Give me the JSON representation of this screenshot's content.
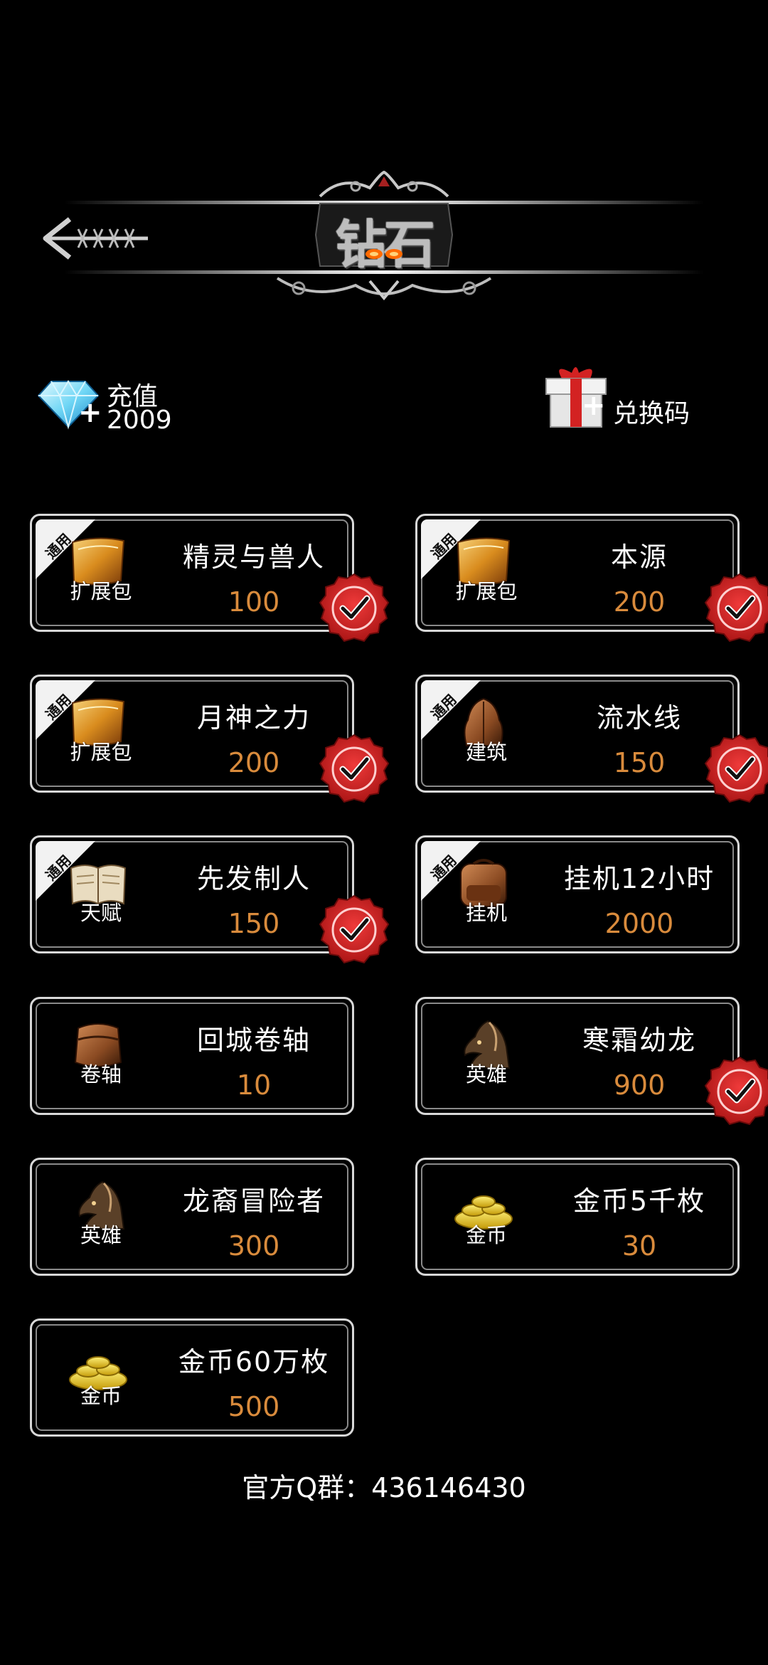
{
  "header": {
    "title": "钻石",
    "back_label": "××××"
  },
  "account": {
    "recharge_label": "充值",
    "diamond_count": "2009",
    "redeem_label": "兑换码"
  },
  "items": [
    {
      "tag": "通用",
      "category": "扩展包",
      "name": "精灵与兽人",
      "price": "100",
      "owned": true,
      "icon": "scroll-icon"
    },
    {
      "tag": "通用",
      "category": "扩展包",
      "name": "本源",
      "price": "200",
      "owned": true,
      "icon": "scroll-icon"
    },
    {
      "tag": "通用",
      "category": "扩展包",
      "name": "月神之力",
      "price": "200",
      "owned": true,
      "icon": "scroll-icon"
    },
    {
      "tag": "通用",
      "category": "建筑",
      "name": "流水线",
      "price": "150",
      "owned": true,
      "icon": "building-icon"
    },
    {
      "tag": "通用",
      "category": "天赋",
      "name": "先发制人",
      "price": "150",
      "owned": true,
      "icon": "book-icon"
    },
    {
      "tag": "通用",
      "category": "挂机",
      "name": "挂机12小时",
      "price": "2000",
      "owned": false,
      "icon": "backpack-icon"
    },
    {
      "tag": "",
      "category": "卷轴",
      "name": "回城卷轴",
      "price": "10",
      "owned": false,
      "icon": "bag-icon"
    },
    {
      "tag": "",
      "category": "英雄",
      "name": "寒霜幼龙",
      "price": "900",
      "owned": true,
      "icon": "hero-icon"
    },
    {
      "tag": "",
      "category": "英雄",
      "name": "龙裔冒险者",
      "price": "300",
      "owned": false,
      "icon": "hero-icon"
    },
    {
      "tag": "",
      "category": "金币",
      "name": "金币5千枚",
      "price": "30",
      "owned": false,
      "icon": "gold-coins-icon"
    },
    {
      "tag": "",
      "category": "金币",
      "name": "金币60万枚",
      "price": "500",
      "owned": false,
      "icon": "gold-coins-icon"
    }
  ],
  "footer": {
    "qq_group": "官方Q群：436146430"
  },
  "colors": {
    "price": "#d98b3c",
    "check_red": "#d62828",
    "frame": "#d8d8d8"
  }
}
